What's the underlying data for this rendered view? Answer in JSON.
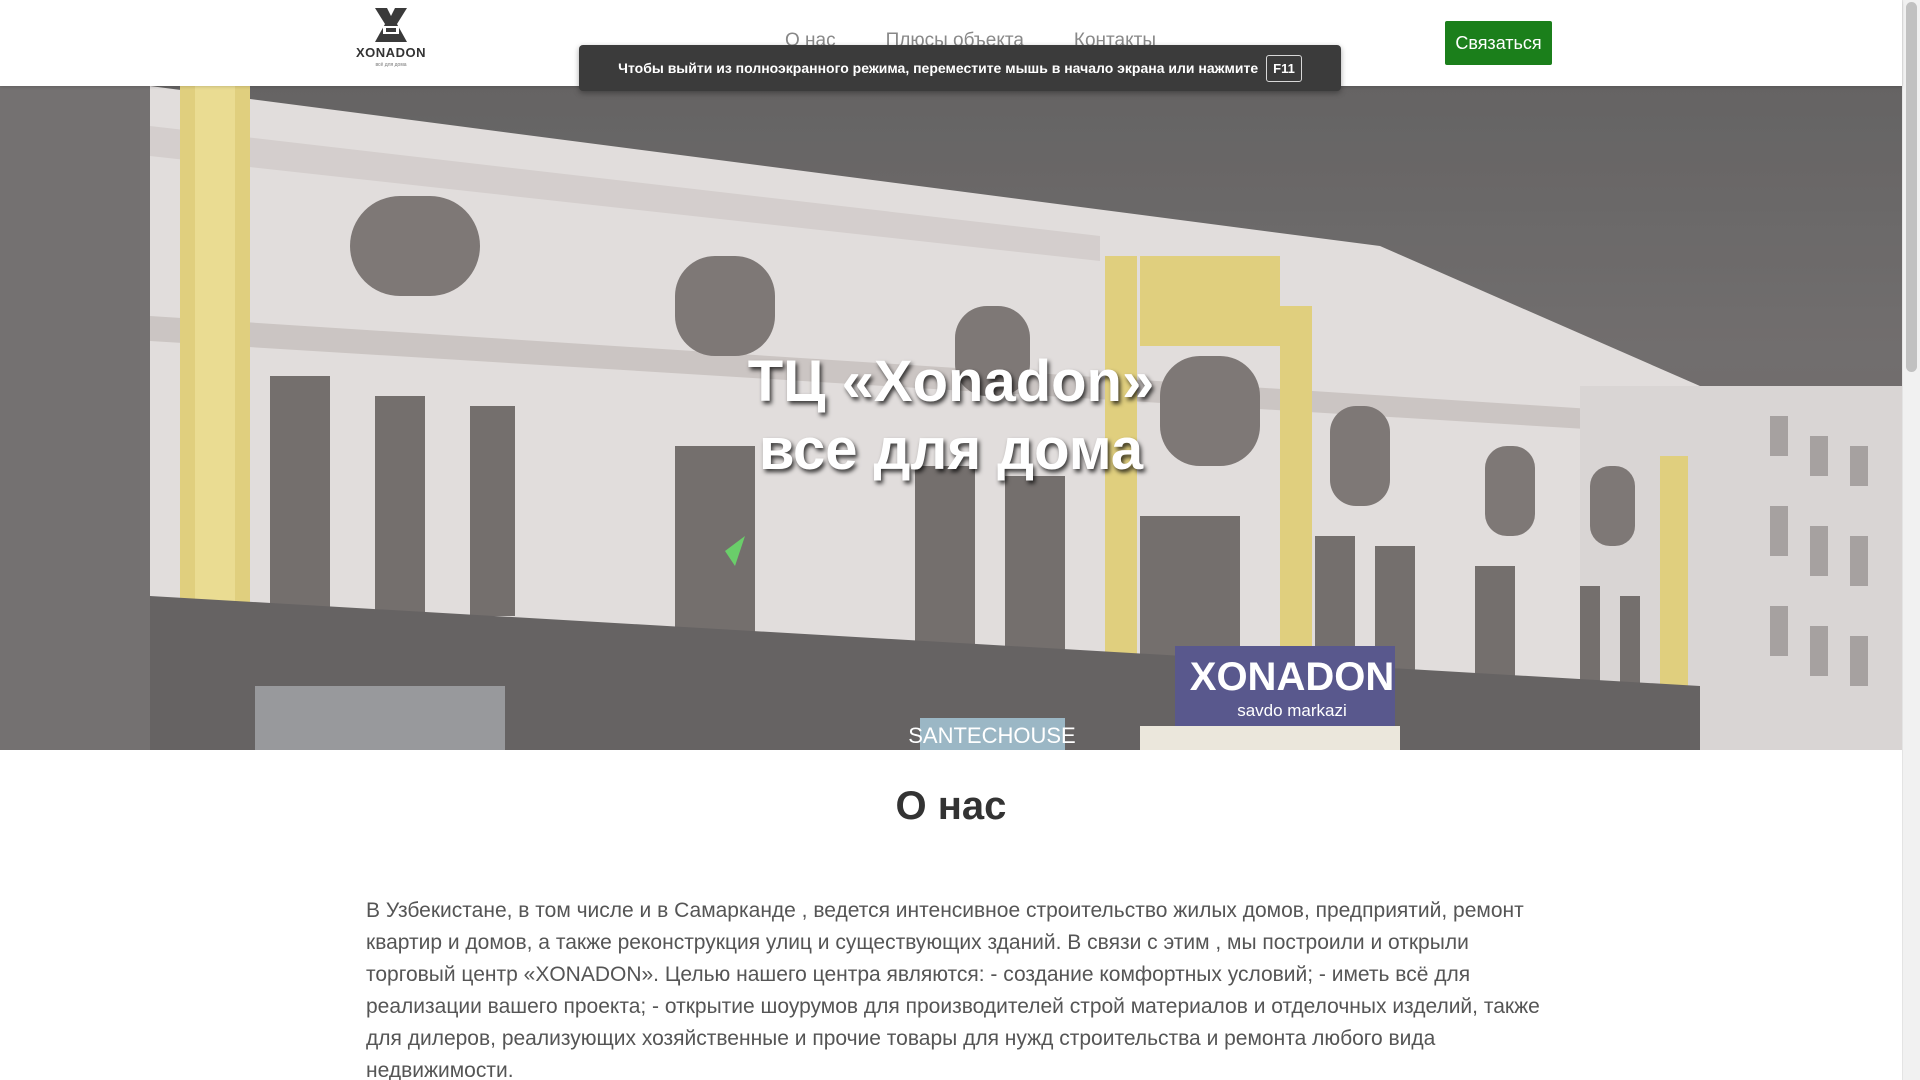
{
  "header": {
    "logo_text": "XONADON",
    "logo_tagline": "всё для дома",
    "nav": [
      {
        "label": "О нас"
      },
      {
        "label": "Плюсы объекта"
      },
      {
        "label": "Контакты"
      }
    ],
    "contact_button": "Связаться"
  },
  "fullscreen_notice": {
    "text": "Чтобы выйти из полноэкранного режима, переместите мышь в начало экрана или нажмите",
    "key": "F11"
  },
  "hero": {
    "title_line1": "ТЦ «Xonadon»",
    "title_line2": "все для дома",
    "sign_main": "XONADON",
    "sign_sub": "savdo markazi",
    "shop_sign": "SANTECHOUSE"
  },
  "about": {
    "title": "О нас",
    "text": "В Узбекистане, в том числе и в Самарканде , ведется интенсивное строительство жилых домов, предприятий, ремонт квартир и домов, а также реконструкция улиц и существующих зданий. В связи с этим , мы построили и открыли торговый центр «XONADON». Целью нашего центра являются: - создание комфортных условий; - иметь всё для реализации вашего проекта; - открытие шоурумов для производителей строй материалов и отделочных изделий, также для дилеров, реализующих хозяйственные и прочие товары для нужд строительства и ремонта любого вида недвижимости."
  },
  "colors": {
    "accent_green": "#1b7f1b",
    "notice_bg": "#3b3b3b",
    "text_dark": "#333333",
    "text_body": "#555555",
    "nav_text": "#888888"
  }
}
